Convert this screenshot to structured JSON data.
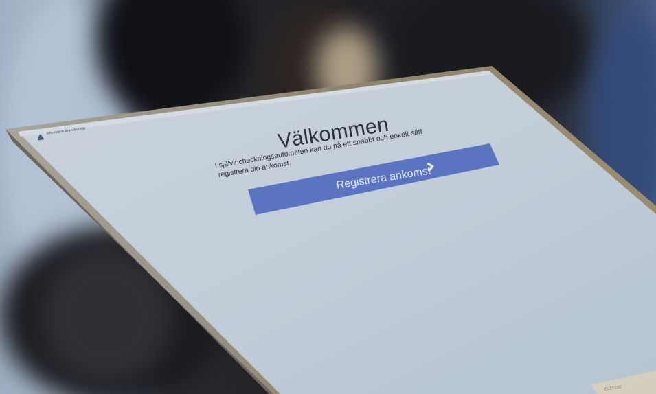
{
  "kiosk": {
    "header_label": "Information lära Vårdmiljö",
    "title": "Välkommen",
    "intro_line_1": "I självincheckningsautomaten kan du på ett snabbt och enkelt sätt",
    "intro_line_2": "registrera din ankomst.",
    "register_button_label": "Registrera ankomst",
    "corner_label": "ELITESE"
  },
  "colors": {
    "screen": "#c4cfd9",
    "button": "#5a74c2",
    "bezel": "#8c826e"
  }
}
